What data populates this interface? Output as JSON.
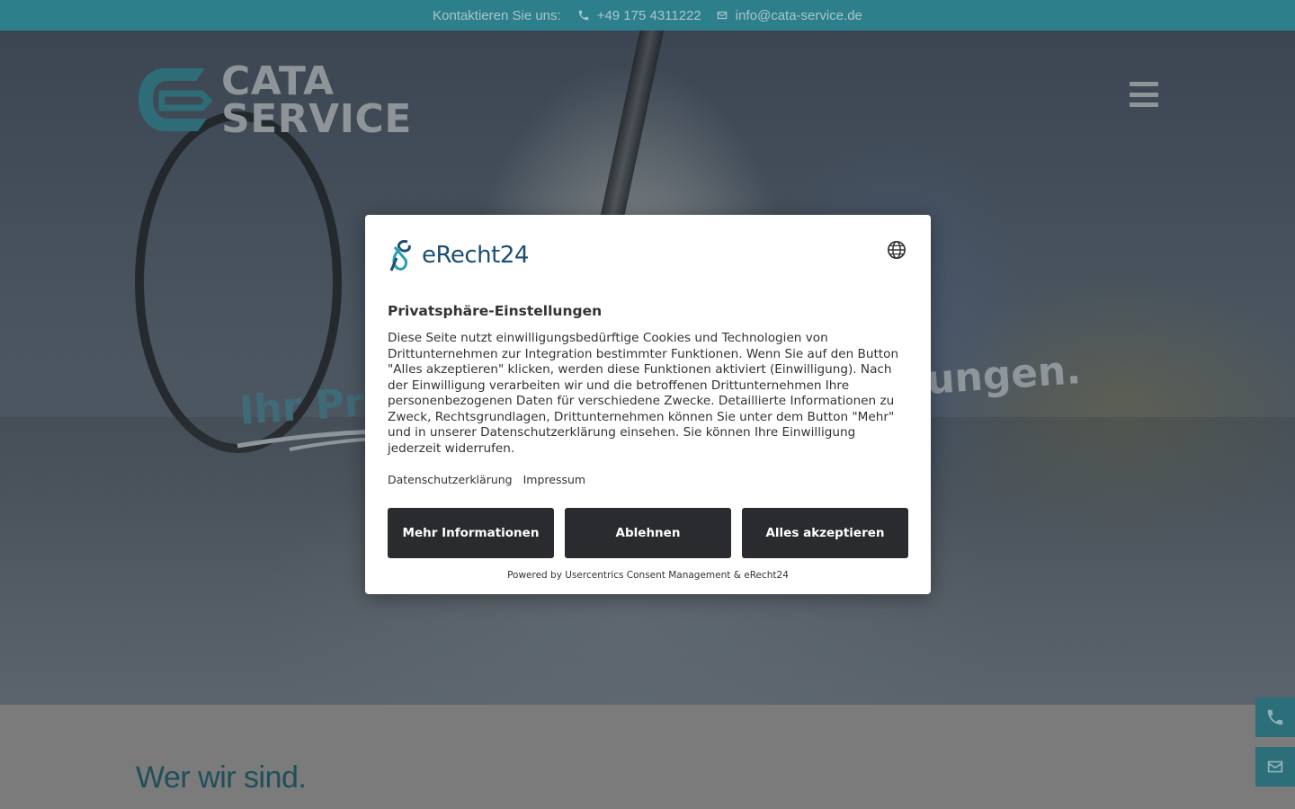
{
  "topbar": {
    "contact_label": "Kontaktieren Sie uns:",
    "phone": "+49 175 4311222",
    "email": "info@cata-service.de",
    "phone_icon": "phone-icon",
    "email_icon": "envelope-icon"
  },
  "header": {
    "logo_line1": "CATA",
    "logo_line2": "SERVICE",
    "menu_icon": "hamburger-icon"
  },
  "hero": {
    "title_left_visible": "Ihr Pro",
    "title_right_visible": "ungen."
  },
  "about": {
    "heading": "Wer wir sind."
  },
  "floating": {
    "phone_icon": "phone-icon",
    "email_icon": "envelope-icon"
  },
  "consent": {
    "brand": "eRecht24",
    "title": "Privatsphäre-Einstellungen",
    "description": "Diese Seite nutzt einwilligungsbedürftige Cookies und Technologien von Drittunternehmen zur Integration bestimmter Funktionen. Wenn Sie auf den Button \"Alles akzeptieren\" klicken, werden diese Funktionen aktiviert (Einwilligung). Nach der Einwilligung verarbeiten wir und die betroffenen Drittunternehmen Ihre personenbezogenen Daten für verschiedene Zwecke. Detaillierte Informationen zu Zweck, Rechtsgrundlagen, Drittunternehmen können Sie unter dem Button \"Mehr\" und in unserer Datenschutzerklärung einsehen. Sie können Ihre Einwilligung jederzeit widerrufen.",
    "link_privacy": "Datenschutzerklärung",
    "link_imprint": "Impressum",
    "btn_more": "Mehr Informationen",
    "btn_reject": "Ablehnen",
    "btn_accept": "Alles akzeptieren",
    "powered_by": "Powered by Usercentrics Consent Management & eRecht24",
    "language_icon": "globe-icon"
  },
  "colors": {
    "topbar_bg": "#2e7f8c",
    "brand_teal": "#2e7f8c",
    "button_dark": "#2a2b2e",
    "heading_teal": "#1f4f59"
  }
}
